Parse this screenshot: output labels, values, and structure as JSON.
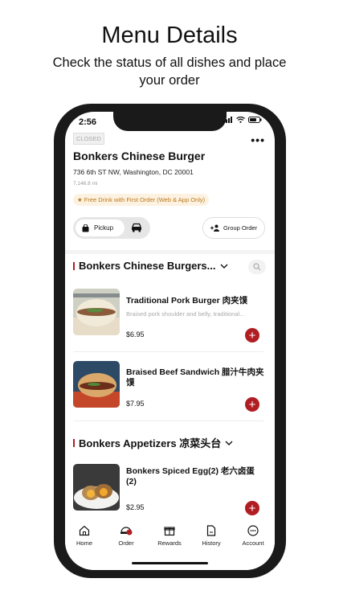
{
  "promo_header": {
    "title": "Menu Details",
    "subtitle": "Check the status of all dishes and place your order"
  },
  "status_bar": {
    "time": "2:56"
  },
  "restaurant": {
    "status": "CLOSED",
    "name": "Bonkers Chinese Burger",
    "address": "736 6th ST NW, Washington, DC 20001",
    "distance": "7,146.8 mi",
    "promo": "★ Free Drink with First Order (Web & App Only)"
  },
  "order_mode": {
    "pickup_label": "Pickup",
    "group_order_label": "Group Order"
  },
  "categories": [
    {
      "title": "Bonkers Chinese Burgers...",
      "items": [
        {
          "name": "Traditional Pork Burger 肉夹馍",
          "description": "Braised pork shoulder and belly, traditional...",
          "price": "$6.95"
        },
        {
          "name": "Braised Beef Sandwich  腊汁牛肉夹馍",
          "description": "",
          "price": "$7.95"
        }
      ]
    },
    {
      "title": "Bonkers Appetizers 凉菜头台",
      "items": [
        {
          "name": "Bonkers Spiced Egg(2) 老六卤蛋(2)",
          "description": "",
          "price": "$2.95"
        }
      ]
    }
  ],
  "tabs": [
    {
      "label": "Home",
      "icon": "home-icon"
    },
    {
      "label": "Order",
      "icon": "order-icon"
    },
    {
      "label": "Rewards",
      "icon": "rewards-icon"
    },
    {
      "label": "History",
      "icon": "history-icon"
    },
    {
      "label": "Account",
      "icon": "account-icon"
    }
  ],
  "colors": {
    "accent": "#b01e23",
    "promo_text": "#b9771a",
    "promo_bg": "#fdf2e1"
  }
}
